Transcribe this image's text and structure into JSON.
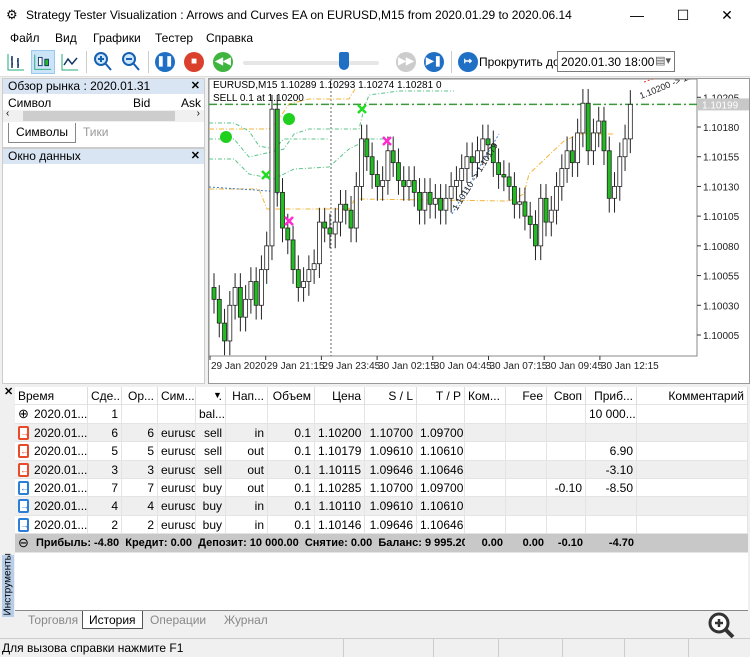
{
  "window": {
    "title": "Strategy Tester Visualization : Arrows and Curves EA on EURUSD,M15 from 2020.01.29 to 2020.06.14",
    "minimize": "—",
    "maximize": "☐",
    "close": "✕"
  },
  "menu": [
    "Файл",
    "Вид",
    "Графики",
    "Тестер",
    "Справка"
  ],
  "toolbar": {
    "scroll_label": "Прокрутить до",
    "scroll_date": "2020.01.30 18:00",
    "slider_value_percent": 75
  },
  "market_watch": {
    "title": "Обзор рынка : 2020.01.31",
    "columns": [
      "Символ",
      "Bid",
      "Ask"
    ],
    "tabs": [
      "Символы",
      "Тики"
    ],
    "active_tab": 0
  },
  "data_window": {
    "title": "Окно данных"
  },
  "chart": {
    "header": "EURUSD,M15  1.10289 1.10293 1.10274 1.10281  0",
    "order_line": "SELL 0.1 at 1.10200",
    "current_price": "1.10199",
    "trade_labels": [
      "1.10200 -> 1.",
      "1.10110 -> 1.10179"
    ]
  },
  "chart_data": {
    "type": "candlestick",
    "symbol": "EURUSD",
    "timeframe": "M15",
    "price_ticks": [
      "1.10205",
      "1.10180",
      "1.10155",
      "1.10130",
      "1.10105",
      "1.10080",
      "1.10055",
      "1.10030",
      "1.10005"
    ],
    "time_ticks": [
      "29 Jan 2020",
      "29 Jan 21:15",
      "29 Jan 23:45",
      "30 Jan 02:15",
      "30 Jan 04:45",
      "30 Jan 07:15",
      "30 Jan 09:45",
      "30 Jan 12:15"
    ],
    "closes": [
      1.10035,
      1.10015,
      1.1,
      1.1003,
      1.10045,
      1.1002,
      1.10035,
      1.1005,
      1.1003,
      1.1006,
      1.1008,
      1.10195,
      1.10125,
      1.10095,
      1.10085,
      1.1006,
      1.10045,
      1.1005,
      1.1006,
      1.10065,
      1.101,
      1.10095,
      1.1009,
      1.101,
      1.10115,
      1.1011,
      1.10095,
      1.1013,
      1.1017,
      1.10155,
      1.1014,
      1.1013,
      1.10135,
      1.1016,
      1.1015,
      1.10135,
      1.1013,
      1.10135,
      1.10125,
      1.1011,
      1.10125,
      1.10115,
      1.1012,
      1.1011,
      1.1012,
      1.1013,
      1.10135,
      1.10145,
      1.10155,
      1.1015,
      1.1016,
      1.1017,
      1.10165,
      1.1015,
      1.1014,
      1.10138,
      1.1013,
      1.10115,
      1.10117,
      1.10105,
      1.10098,
      1.1008,
      1.1012,
      1.101,
      1.1011,
      1.1013,
      1.10145,
      1.1016,
      1.1015,
      1.10175,
      1.102,
      1.1016,
      1.10175,
      1.10185,
      1.1016,
      1.1012,
      1.1013,
      1.10155,
      1.1017,
      1.10199
    ],
    "colors": {
      "bull": "#ffffff",
      "bear": "#22bb22",
      "grid_line": "#3a9a3a"
    }
  },
  "history": {
    "columns": [
      "Время",
      "Сде...",
      "Ор...",
      "Сим...",
      ".",
      "Нап...",
      "Объем",
      "Цена",
      "S / L",
      "T / P",
      "Ком...",
      "Fee",
      "Своп",
      "Приб...",
      "Комментарий"
    ],
    "rows": [
      {
        "icon": "balance",
        "cells": [
          "2020.01....",
          "1",
          "",
          "",
          "bal...",
          "",
          "",
          "",
          "",
          "",
          "",
          "",
          "",
          "10 000...",
          ""
        ]
      },
      {
        "icon": "sell-in",
        "cells": [
          "2020.01....",
          "6",
          "6",
          "eurusd",
          "sell",
          "in",
          "0.1",
          "1.10200",
          "1.10700",
          "1.09700",
          "",
          "",
          "",
          "",
          ""
        ]
      },
      {
        "icon": "sell-out",
        "cells": [
          "2020.01....",
          "5",
          "5",
          "eurusd",
          "sell",
          "out",
          "0.1",
          "1.10179",
          "1.09610",
          "1.10610",
          "",
          "",
          "",
          "6.90",
          ""
        ]
      },
      {
        "icon": "sell-out",
        "cells": [
          "2020.01....",
          "3",
          "3",
          "eurusd",
          "sell",
          "out",
          "0.1",
          "1.10115",
          "1.09646",
          "1.10646",
          "",
          "",
          "",
          "-3.10",
          ""
        ]
      },
      {
        "icon": "buy-out",
        "cells": [
          "2020.01....",
          "7",
          "7",
          "eurusd",
          "buy",
          "out",
          "0.1",
          "1.10285",
          "1.10700",
          "1.09700",
          "",
          "",
          "-0.10",
          "-8.50",
          ""
        ]
      },
      {
        "icon": "buy-in",
        "cells": [
          "2020.01....",
          "4",
          "4",
          "eurusd",
          "buy",
          "in",
          "0.1",
          "1.10110",
          "1.09610",
          "1.10610",
          "",
          "",
          "",
          "",
          ""
        ]
      },
      {
        "icon": "buy-in",
        "cells": [
          "2020.01....",
          "2",
          "2",
          "eurusd",
          "buy",
          "in",
          "0.1",
          "1.10146",
          "1.09646",
          "1.10646",
          "",
          "",
          "",
          "",
          ""
        ]
      }
    ],
    "summary": {
      "text": "Прибыль: -4.80  Кредит: 0.00  Депозит: 10 000.00  Снятие: 0.00  Баланс: 9 995.20",
      "commission": "0.00",
      "fee": "0.00",
      "swap": "-0.10",
      "profit": "-4.70"
    }
  },
  "toolbox": {
    "side_label": "Инструменты",
    "tabs": [
      "Торговля",
      "История",
      "Операции",
      "Журнал"
    ],
    "active_tab": 1
  },
  "status": {
    "text": "Для вызова справки нажмите F1"
  }
}
